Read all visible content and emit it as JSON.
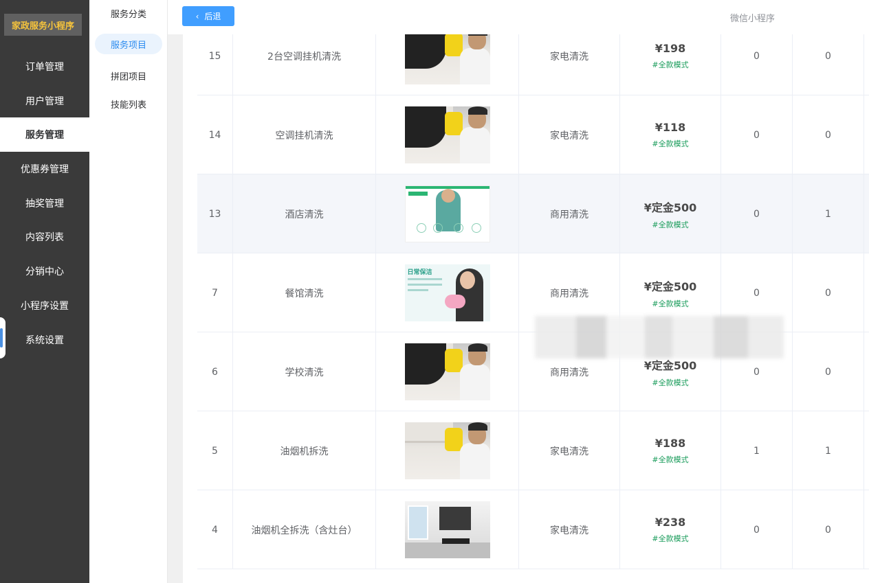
{
  "app": {
    "brand": "家政服务小程序",
    "top_label": "微信小程序",
    "back_label": "后退"
  },
  "sidebar": {
    "items": [
      {
        "label": "订单管理"
      },
      {
        "label": "用户管理"
      },
      {
        "label": "服务管理"
      },
      {
        "label": "优惠券管理"
      },
      {
        "label": "抽奖管理"
      },
      {
        "label": "内容列表"
      },
      {
        "label": "分销中心"
      },
      {
        "label": "小程序设置"
      },
      {
        "label": "系统设置"
      }
    ]
  },
  "submenu": {
    "items": [
      {
        "label": "服务分类"
      },
      {
        "label": "服务项目"
      },
      {
        "label": "拼团项目"
      },
      {
        "label": "技能列表"
      }
    ]
  },
  "table": {
    "rows": [
      {
        "id": "15",
        "name": "2台空调挂机清洗",
        "image": "ac-cleaning",
        "category": "家电清洗",
        "price": "¥198",
        "mode": "#全款模式",
        "a": "0",
        "b": "0"
      },
      {
        "id": "14",
        "name": "空调挂机清洗",
        "image": "ac-cleaning",
        "category": "家电清洗",
        "price": "¥118",
        "mode": "#全款模式",
        "a": "0",
        "b": "0"
      },
      {
        "id": "13",
        "name": "酒店清洗",
        "image": "hotel-cleaning",
        "category": "商用清洗",
        "price": "¥定金500",
        "mode": "#全款模式",
        "a": "0",
        "b": "1"
      },
      {
        "id": "7",
        "name": "餐馆清洗",
        "image": "daily-cleaning",
        "category": "商用清洗",
        "price": "¥定金500",
        "mode": "#全款模式",
        "a": "0",
        "b": "0"
      },
      {
        "id": "6",
        "name": "学校清洗",
        "image": "ac-cleaning",
        "category": "商用清洗",
        "price": "¥定金500",
        "mode": "#全款模式",
        "a": "0",
        "b": "0"
      },
      {
        "id": "5",
        "name": "油烟机拆洗",
        "image": "hood-cleaning",
        "category": "家电清洗",
        "price": "¥188",
        "mode": "#全款模式",
        "a": "1",
        "b": "1"
      },
      {
        "id": "4",
        "name": "油烟机全拆洗（含灶台）",
        "image": "kitchen",
        "category": "家电清洗",
        "price": "¥238",
        "mode": "#全款模式",
        "a": "0",
        "b": "0"
      }
    ]
  },
  "thumb_text": {
    "daily_title": "日常保洁"
  },
  "colors": {
    "sidebar_bg": "#3a3a3a",
    "brand_text": "#f5c33c",
    "accent": "#409eff",
    "mode_text": "#1a9c5b"
  }
}
